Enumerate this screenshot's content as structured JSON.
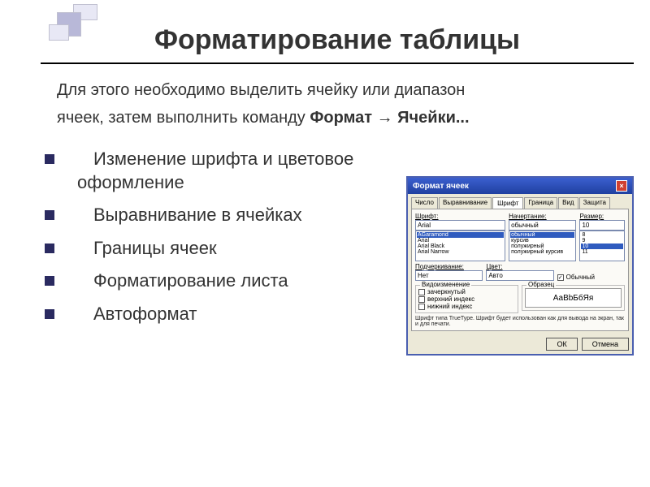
{
  "title": "Форматирование таблицы",
  "intro_line1": "Для этого необходимо выделить ячейку или диапазон",
  "intro_line2_plain": "ячеек, затем выполнить команду ",
  "intro_line2_bold": "Формат → Ячейки...",
  "bullets": [
    "Изменение шрифта и цветовое оформление",
    "Выравнивание в ячейках",
    "Границы ячеек",
    "Форматирование листа",
    "Автоформат"
  ],
  "dialog": {
    "title": "Формат ячеек",
    "close": "×",
    "tabs": [
      "Число",
      "Выравнивание",
      "Шрифт",
      "Граница",
      "Вид",
      "Защита"
    ],
    "active_tab": "Шрифт",
    "font_label": "Шрифт:",
    "font_value": "Arial",
    "font_list": [
      "AGaramond",
      "Arial",
      "Arial Black",
      "Arial Narrow"
    ],
    "font_list_selected": "Arial",
    "style_label": "Начертание:",
    "style_value": "обычный",
    "style_list": [
      "обычный",
      "курсив",
      "полужирный",
      "полужирный курсив"
    ],
    "style_list_selected": "обычный",
    "size_label": "Размер:",
    "size_value": "10",
    "size_list": [
      "8",
      "9",
      "10",
      "11"
    ],
    "size_list_selected": "10",
    "underline_label": "Подчеркивание:",
    "underline_value": "Нет",
    "color_label": "Цвет:",
    "color_value": "Авто",
    "normal_check": "Обычный",
    "effects_legend": "Видоизменение",
    "effects": [
      "зачеркнутый",
      "верхний индекс",
      "нижний индекс"
    ],
    "sample_legend": "Образец",
    "sample_text": "АаВbБбЯя",
    "hint": "Шрифт типа TrueType. Шрифт будет использован как для вывода на экран, так и для печати.",
    "ok": "ОК",
    "cancel": "Отмена"
  }
}
